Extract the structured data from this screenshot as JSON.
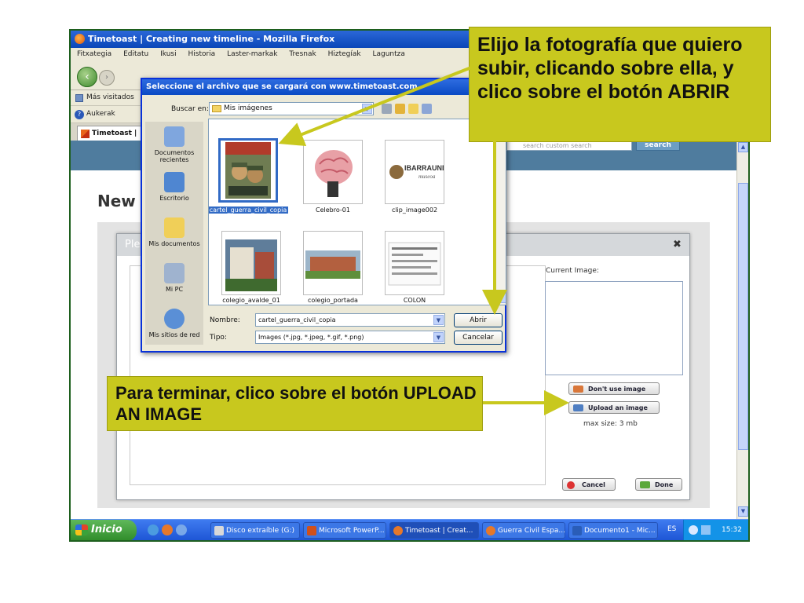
{
  "browser": {
    "title": "Timetoast | Creating new timeline - Mozilla Firefox",
    "menu": [
      "Fitxategia",
      "Editatu",
      "Ikusi",
      "Historia",
      "Laster-markak",
      "Tresnak",
      "Hiztegíak",
      "Laguntza"
    ],
    "bookmark": "Más visitados",
    "toolbar_item": "Aukerak",
    "tab_label": "Timetoast |"
  },
  "page": {
    "heading": "New",
    "search_placeholder": "search custom search",
    "search_button": "search"
  },
  "upload_dialog": {
    "title": "Ple",
    "current_image_label": "Current Image:",
    "dont_use_label": "Don't use image",
    "upload_label": "Upload an image",
    "max_size": "max size: 3 mb",
    "cancel_label": "Cancel",
    "done_label": "Done"
  },
  "file_dialog": {
    "title": "Seleccione el archivo que se cargará con www.timetoast.com",
    "look_in_label": "Buscar en:",
    "look_in_value": "Mis imágenes",
    "places": [
      "Documentos recientes",
      "Escritorio",
      "Mis documentos",
      "Mi PC",
      "Mis sitios de red"
    ],
    "files": [
      {
        "name": "cartel_guerra_civil_copia"
      },
      {
        "name": "Celebro-01"
      },
      {
        "name": "clip_image002"
      },
      {
        "name": "colegio_avalde_01"
      },
      {
        "name": "colegio_portada"
      },
      {
        "name": "COLON"
      }
    ],
    "thumb_text": [
      "IBARRAUNDI",
      "museoa"
    ],
    "name_label": "Nombre:",
    "name_value": "cartel_guerra_civil_copia",
    "type_label": "Tipo:",
    "type_value": "Images (*.jpg, *.jpeg, *.gif, *.png)",
    "open_label": "Abrir",
    "cancel_label": "Cancelar"
  },
  "taskbar": {
    "start_label": "Inicio",
    "tasks": [
      "Disco extraíble (G:)",
      "Microsoft PowerP...",
      "Timetoast | Creat...",
      "Guerra Civil Espa...",
      "Documento1 - Mic..."
    ],
    "lang": "ES",
    "time": "15:32"
  },
  "callouts": {
    "top": "Elijo la fotografía que quiero subir, clicando sobre ella, y clico sobre el botón ABRIR",
    "bottom": "Para terminar, clico sobre el botón UPLOAD AN IMAGE"
  },
  "colors": {
    "callout_bg": "#c8c81e",
    "title_blue": "#0a4ac4",
    "selection": "#316ac5",
    "arrow": "#c8c81e"
  }
}
